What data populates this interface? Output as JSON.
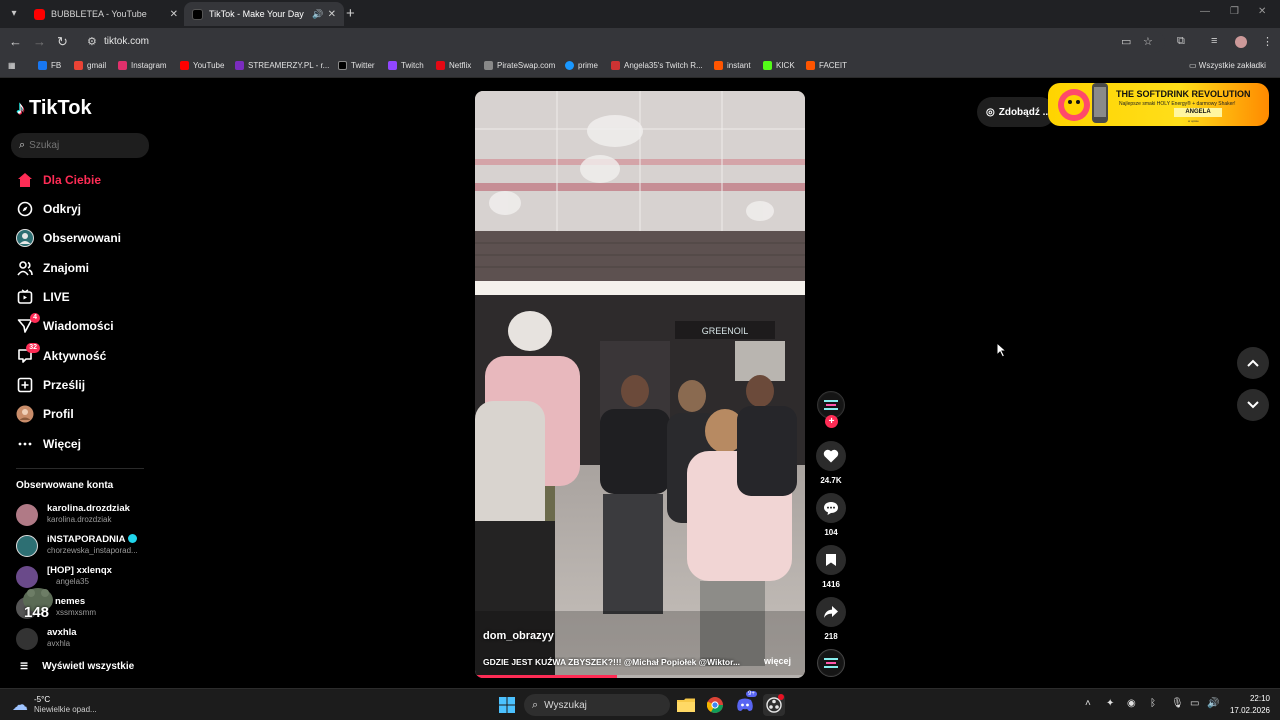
{
  "browser": {
    "tabs": [
      {
        "title": "BUBBLETEA - YouTube",
        "favicon_color": "#ff0000"
      },
      {
        "title": "TikTok - Make Your Day",
        "favicon_color": "#000000"
      }
    ],
    "url": "tiktok.com",
    "bookmarks": [
      {
        "label": "FB",
        "color": "#1877f2"
      },
      {
        "label": "gmail",
        "color": "#ea4335"
      },
      {
        "label": "Instagram",
        "color": "#e1306c"
      },
      {
        "label": "YouTube",
        "color": "#ff0000"
      },
      {
        "label": "STREAMERZY.PL - r...",
        "color": "#7b2cbf"
      },
      {
        "label": "Twitter",
        "color": "#000000"
      },
      {
        "label": "Twitch",
        "color": "#9146ff"
      },
      {
        "label": "Netflix",
        "color": "#e50914"
      },
      {
        "label": "PirateSwap.com",
        "color": "#888888"
      },
      {
        "label": "prime",
        "color": "#1a98ff"
      },
      {
        "label": "Angela35's Twitch R...",
        "color": "#cc3333"
      },
      {
        "label": "instant",
        "color": "#ff5500"
      },
      {
        "label": "KICK",
        "color": "#53fc18"
      },
      {
        "label": "FACEIT",
        "color": "#ff5500"
      }
    ],
    "all_bookmarks": "Wszystkie zakładki"
  },
  "sidebar": {
    "logo": "TikTok",
    "search_placeholder": "Szukaj",
    "nav": [
      {
        "label": "Dla Ciebie",
        "icon": "home-icon",
        "active": true
      },
      {
        "label": "Odkryj",
        "icon": "compass-icon"
      },
      {
        "label": "Obserwowani",
        "icon": "following-avatar-icon"
      },
      {
        "label": "Znajomi",
        "icon": "friends-icon"
      },
      {
        "label": "LIVE",
        "icon": "live-icon"
      },
      {
        "label": "Wiadomości",
        "icon": "messages-icon",
        "badge": "4"
      },
      {
        "label": "Aktywność",
        "icon": "activity-icon",
        "badge": "32"
      },
      {
        "label": "Prześlij",
        "icon": "upload-icon"
      },
      {
        "label": "Profil",
        "icon": "profile-avatar-icon"
      },
      {
        "label": "Więcej",
        "icon": "more-icon"
      }
    ],
    "following_title": "Obserwowane konta",
    "following": [
      {
        "name": "karolina.drozdziak",
        "handle": "karolina.drozdziak",
        "color": "#b07a86"
      },
      {
        "name": "iNSTAPORADNIA",
        "handle": "chorzewska_instaporad...",
        "color": "#2d6f73",
        "verified": true
      },
      {
        "name": "[HOP] xxlenqx",
        "handle": "angela35",
        "color": "#6a4a8a"
      },
      {
        "name": "nemes",
        "handle": "xssmxsmm",
        "color": "#555555"
      },
      {
        "name": "avxhla",
        "handle": "avxhla",
        "color": "#333333"
      }
    ],
    "show_all": "Wyświetl wszystkie",
    "overlay_counter": "148"
  },
  "video": {
    "author": "dom_obrazyy",
    "caption": "GDZIE JEST KUŹWA ZBYSZEK?!!! @Michał Popiołek @Wiktor...",
    "more": "więcej",
    "progress": 0.43
  },
  "actions": {
    "likes": "24.7K",
    "comments": "104",
    "saves": "1416",
    "shares": "218"
  },
  "header": {
    "get_coins": "Zdobądź ...",
    "ad": {
      "title": "THE SOFTDRINK REVOLUTION",
      "line": "Najlepsze smaki HOLY Energy® + darmowy Shaker!",
      "code": "ANGELA",
      "small": "w opisie"
    }
  },
  "taskbar": {
    "temperature": "-5°C",
    "weather": "Niewielkie opad...",
    "search": "Wyszukaj",
    "discord_badge": "9+",
    "time": "22:10",
    "date": "17.02.2026"
  },
  "colors": {
    "accent": "#fe2c55",
    "background": "#000000",
    "chrome": "#35363a"
  }
}
